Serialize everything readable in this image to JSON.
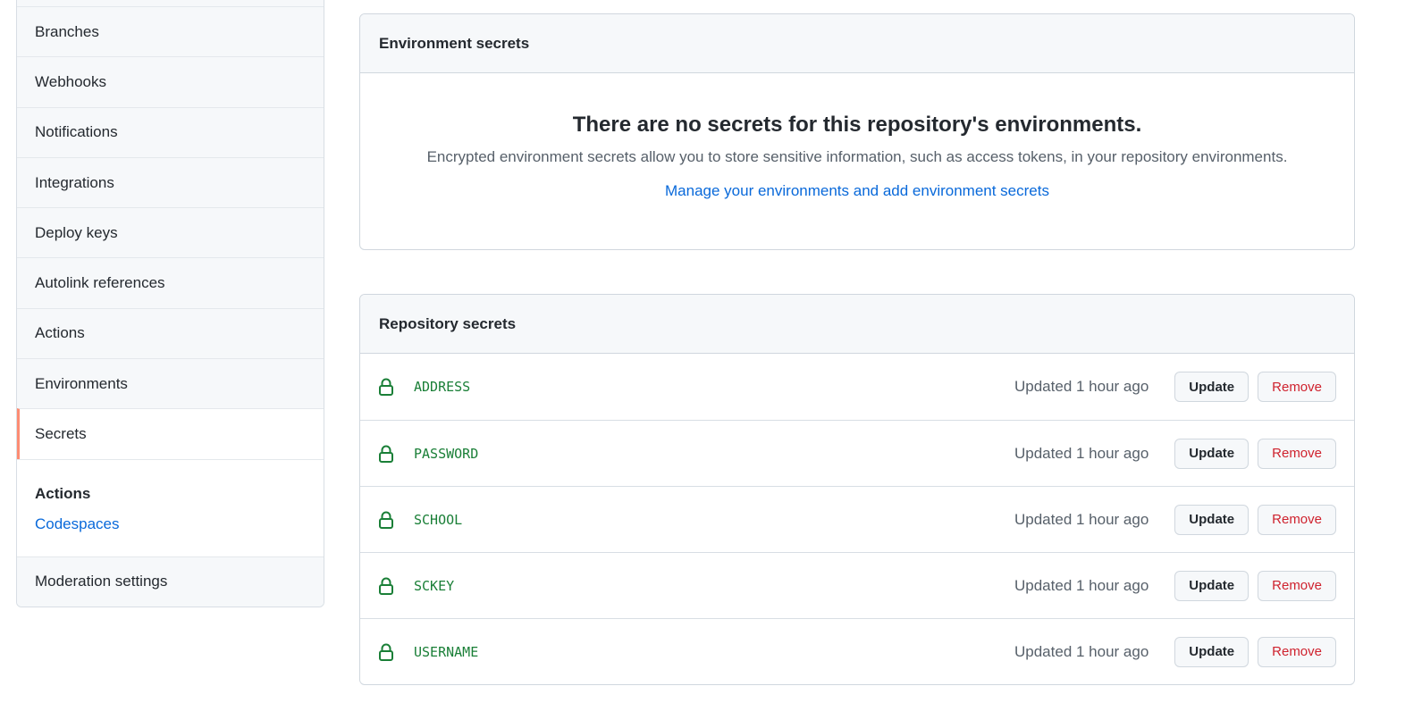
{
  "sidebar": {
    "items": [
      "",
      "Branches",
      "Webhooks",
      "Notifications",
      "Integrations",
      "Deploy keys",
      "Autolink references",
      "Actions",
      "Environments",
      "Secrets"
    ],
    "active": "Secrets",
    "section_title": "Actions",
    "section_link": "Codespaces",
    "last_item": "Moderation settings"
  },
  "env": {
    "title": "Environment secrets",
    "heading": "There are no secrets for this repository's environments.",
    "desc": "Encrypted environment secrets allow you to store sensitive information, such as access tokens, in your repository environments.",
    "link": "Manage your environments and add environment secrets"
  },
  "repo": {
    "title": "Repository secrets",
    "update_label": "Update",
    "remove_label": "Remove",
    "secrets": [
      {
        "name": "ADDRESS",
        "updated": "Updated 1 hour ago"
      },
      {
        "name": "PASSWORD",
        "updated": "Updated 1 hour ago"
      },
      {
        "name": "SCHOOL",
        "updated": "Updated 1 hour ago"
      },
      {
        "name": "SCKEY",
        "updated": "Updated 1 hour ago"
      },
      {
        "name": "USERNAME",
        "updated": "Updated 1 hour ago"
      }
    ]
  },
  "colors": {
    "accent": "#fd8c73",
    "link": "#0969da",
    "secret": "#1a7f37",
    "danger": "#cf222e"
  }
}
